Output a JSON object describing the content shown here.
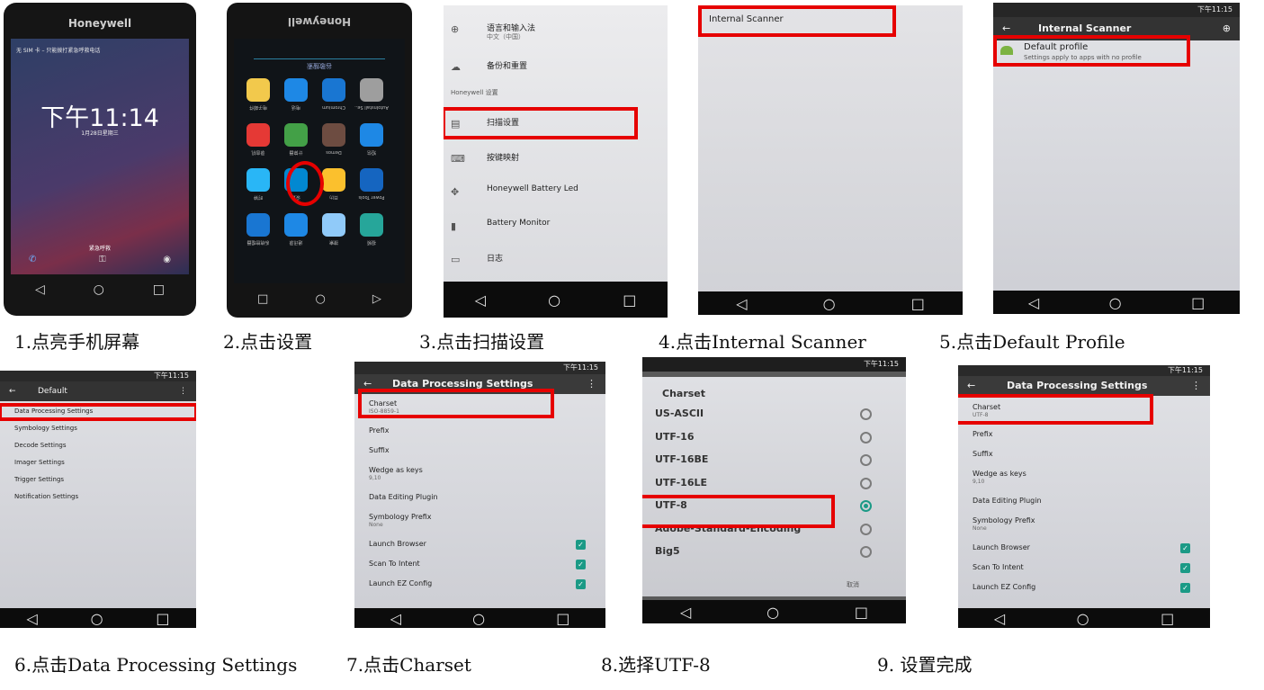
{
  "captions": [
    "1.点亮手机屏幕",
    "2.点击设置",
    "3.点击扫描设置",
    "4.点击Internal Scanner",
    "5.点击Default Profile",
    "6.点击Data Processing Settings",
    "7.点击Charset",
    "8.选择UTF-8",
    "9. 设置完成"
  ],
  "step1": {
    "brand": "Honeywell",
    "status": "无 SIM 卡 – 只能拨打紧急呼救电话",
    "time": "下午11:14",
    "date": "1月28日星期三",
    "emergency": "紧急呼救"
  },
  "step2": {
    "brand": "Honeywell",
    "search": "谷歌搜索",
    "apps": [
      {
        "label": "电子邮件",
        "icon": "email-icon",
        "color": "#f2c94c"
      },
      {
        "label": "电话",
        "icon": "phone-icon",
        "color": "#1e88e5"
      },
      {
        "label": "Chromium",
        "icon": "chromium-icon",
        "color": "#1976d2"
      },
      {
        "label": "AutoInstall Se..",
        "icon": "disc-icon",
        "color": "#9e9e9e"
      },
      {
        "label": "录音机",
        "icon": "recorder-icon",
        "color": "#e53935"
      },
      {
        "label": "计算器",
        "icon": "calculator-icon",
        "color": "#43a047"
      },
      {
        "label": "Demos",
        "icon": "demos-icon",
        "color": "#6d4c41"
      },
      {
        "label": "短信",
        "icon": "messaging-icon",
        "color": "#1e88e5"
      },
      {
        "label": "时钟",
        "icon": "clock-icon",
        "color": "#29b6f6"
      },
      {
        "label": "设置",
        "icon": "gear-icon",
        "color": "#0288d1"
      },
      {
        "label": "日历",
        "icon": "calendar-icon",
        "color": "#fbc02d"
      },
      {
        "label": "Power Tools",
        "icon": "power-tools-icon",
        "color": "#1565c0"
      },
      {
        "label": "系统管理器",
        "icon": "file-manager-icon",
        "color": "#1976d2"
      },
      {
        "label": "通讯录",
        "icon": "contacts-icon",
        "color": "#1e88e5"
      },
      {
        "label": "搜索",
        "icon": "search-icon",
        "color": "#90caf9"
      },
      {
        "label": "视频",
        "icon": "video-icon",
        "color": "#26a69a"
      }
    ]
  },
  "step3": {
    "items": [
      {
        "label": "语言和输入法",
        "sub": "中文（中国）",
        "icon": "globe-icon"
      },
      {
        "label": "备份和重置",
        "sub": "",
        "icon": "cloud-icon"
      },
      {
        "label": "Honeywell 设置",
        "sub": "",
        "icon": ""
      },
      {
        "label": "扫描设置",
        "sub": "",
        "icon": "scanner-icon"
      },
      {
        "label": "按键映射",
        "sub": "",
        "icon": "keyboard-icon"
      },
      {
        "label": "Honeywell Battery Led",
        "sub": "",
        "icon": "led-icon"
      },
      {
        "label": "Battery Monitor",
        "sub": "",
        "icon": "battery-icon"
      },
      {
        "label": "日志",
        "sub": "",
        "icon": "laptop-icon"
      }
    ]
  },
  "step4": {
    "item": "Internal Scanner"
  },
  "step5": {
    "title": "Internal Scanner",
    "status_time": "下午11:15",
    "profile": "Default profile",
    "profile_sub": "Settings apply to apps with no profile"
  },
  "step6": {
    "title": "Default",
    "status_time": "下午11:15",
    "items": [
      "Data Processing Settings",
      "Symbology Settings",
      "Decode Settings",
      "Imager Settings",
      "Trigger Settings",
      "Notification Settings"
    ]
  },
  "step7": {
    "title": "Data Processing Settings",
    "status_time": "下午11:15",
    "items": [
      {
        "label": "Charset",
        "sub": "ISO-8859-1",
        "check": false
      },
      {
        "label": "Prefix",
        "sub": "",
        "check": false
      },
      {
        "label": "Suffix",
        "sub": "",
        "check": false
      },
      {
        "label": "Wedge as keys",
        "sub": "9,10",
        "check": false
      },
      {
        "label": "Data Editing Plugin",
        "sub": "",
        "check": false
      },
      {
        "label": "Symbology Prefix",
        "sub": "None",
        "check": false
      },
      {
        "label": "Launch Browser",
        "sub": "",
        "check": true
      },
      {
        "label": "Scan To Intent",
        "sub": "",
        "check": true
      },
      {
        "label": "Launch EZ Config",
        "sub": "",
        "check": true
      }
    ]
  },
  "step8": {
    "title": "Charset",
    "status_time": "下午11:15",
    "options": [
      "US-ASCII",
      "UTF-16",
      "UTF-16BE",
      "UTF-16LE",
      "UTF-8",
      "Adobe-Standard-Encoding",
      "Big5"
    ],
    "selected": "UTF-8",
    "cancel": "取消"
  },
  "step9": {
    "title": "Data Processing Settings",
    "status_time": "下午11:15",
    "items": [
      {
        "label": "Charset",
        "sub": "UTF-8",
        "check": false
      },
      {
        "label": "Prefix",
        "sub": "",
        "check": false
      },
      {
        "label": "Suffix",
        "sub": "",
        "check": false
      },
      {
        "label": "Wedge as keys",
        "sub": "9,10",
        "check": false
      },
      {
        "label": "Data Editing Plugin",
        "sub": "",
        "check": false
      },
      {
        "label": "Symbology Prefix",
        "sub": "None",
        "check": false
      },
      {
        "label": "Launch Browser",
        "sub": "",
        "check": true
      },
      {
        "label": "Scan To Intent",
        "sub": "",
        "check": true
      },
      {
        "label": "Launch EZ Config",
        "sub": "",
        "check": true
      }
    ]
  },
  "nav": {
    "back": "◁",
    "home": "○",
    "recents": "□"
  },
  "colors": {
    "highlight": "#e60000",
    "teal": "#1b9a86"
  }
}
